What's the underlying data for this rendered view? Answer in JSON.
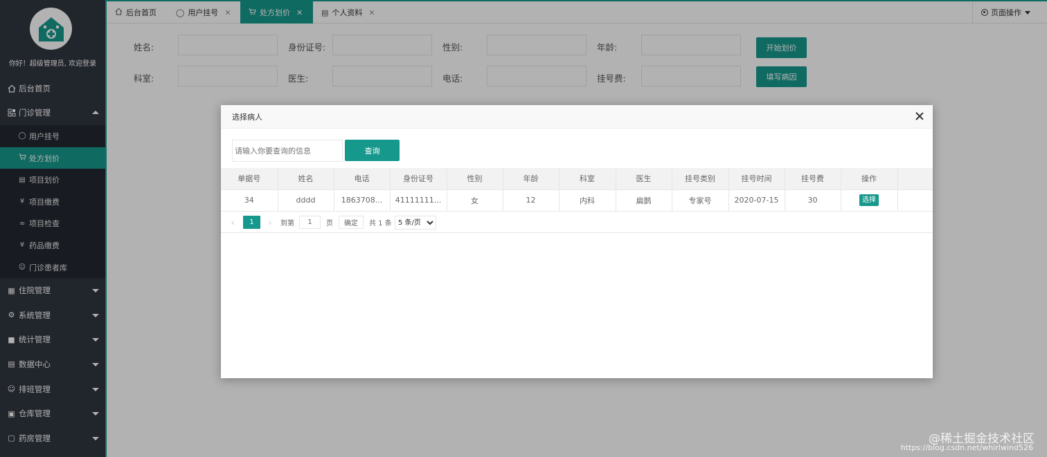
{
  "sidebar": {
    "welcome": "你好！超级管理员, 欢迎登录",
    "items": [
      {
        "label": "后台首页",
        "icon": "home-icon"
      },
      {
        "label": "门诊管理",
        "icon": "grid-icon",
        "expanded": true,
        "children": [
          {
            "label": "用户挂号",
            "icon": "user-icon"
          },
          {
            "label": "处方划价",
            "icon": "cart-icon",
            "active": true
          },
          {
            "label": "项目划价",
            "icon": "doc-icon"
          },
          {
            "label": "项目缴费",
            "icon": "yen-icon"
          },
          {
            "label": "项目检查",
            "icon": "infinity-icon"
          },
          {
            "label": "药品缴费",
            "icon": "yen-icon"
          },
          {
            "label": "门诊患者库",
            "icon": "person-icon"
          }
        ]
      },
      {
        "label": "住院管理",
        "icon": "building-icon"
      },
      {
        "label": "系统管理",
        "icon": "gear-icon"
      },
      {
        "label": "统计管理",
        "icon": "chat-icon"
      },
      {
        "label": "数据中心",
        "icon": "doc-icon"
      },
      {
        "label": "排班管理",
        "icon": "users-icon"
      },
      {
        "label": "仓库管理",
        "icon": "boxes-icon"
      },
      {
        "label": "药房管理",
        "icon": "book-icon"
      }
    ]
  },
  "tabs": [
    {
      "label": "后台首页",
      "icon": "home-icon",
      "closable": false
    },
    {
      "label": "用户挂号",
      "icon": "user-icon",
      "closable": true
    },
    {
      "label": "处方划价",
      "icon": "cart-icon",
      "closable": true,
      "active": true
    },
    {
      "label": "个人资料",
      "icon": "card-icon",
      "closable": true
    }
  ],
  "page_ops": "页面操作",
  "form": {
    "name_label": "姓名:",
    "id_label": "身份证号:",
    "gender_label": "性别:",
    "age_label": "年龄:",
    "dept_label": "科室:",
    "doctor_label": "医生:",
    "phone_label": "电话:",
    "fee_label": "挂号费:",
    "start_btn": "开始划价",
    "reason_btn": "填写病因"
  },
  "modal": {
    "title": "选择病人",
    "search_placeholder": "请输入你要查询的信息",
    "search_btn": "查询",
    "columns": [
      "单据号",
      "姓名",
      "电话",
      "身份证号",
      "性别",
      "年龄",
      "科室",
      "医生",
      "挂号类别",
      "挂号时间",
      "挂号费",
      "操作"
    ],
    "rows": [
      {
        "id": "34",
        "name": "dddd",
        "phone": "1863708...",
        "idcard": "41111111...",
        "gender": "女",
        "age": "12",
        "dept": "内科",
        "doctor": "扁鹊",
        "type": "专家号",
        "time": "2020-07-15",
        "fee": "30",
        "action": "选择"
      }
    ],
    "pager": {
      "current": "1",
      "goto_label": "到第",
      "goto_value": "1",
      "page_unit": "页",
      "confirm": "确定",
      "total": "共 1 条",
      "page_size": "5 条/页"
    }
  },
  "watermark": "@稀土掘金技术社区",
  "watermark_url": "https://blog.csdn.net/whirlwind526",
  "colors": {
    "accent": "#16998c",
    "sidebar": "#30353f",
    "submenu": "#232831"
  }
}
